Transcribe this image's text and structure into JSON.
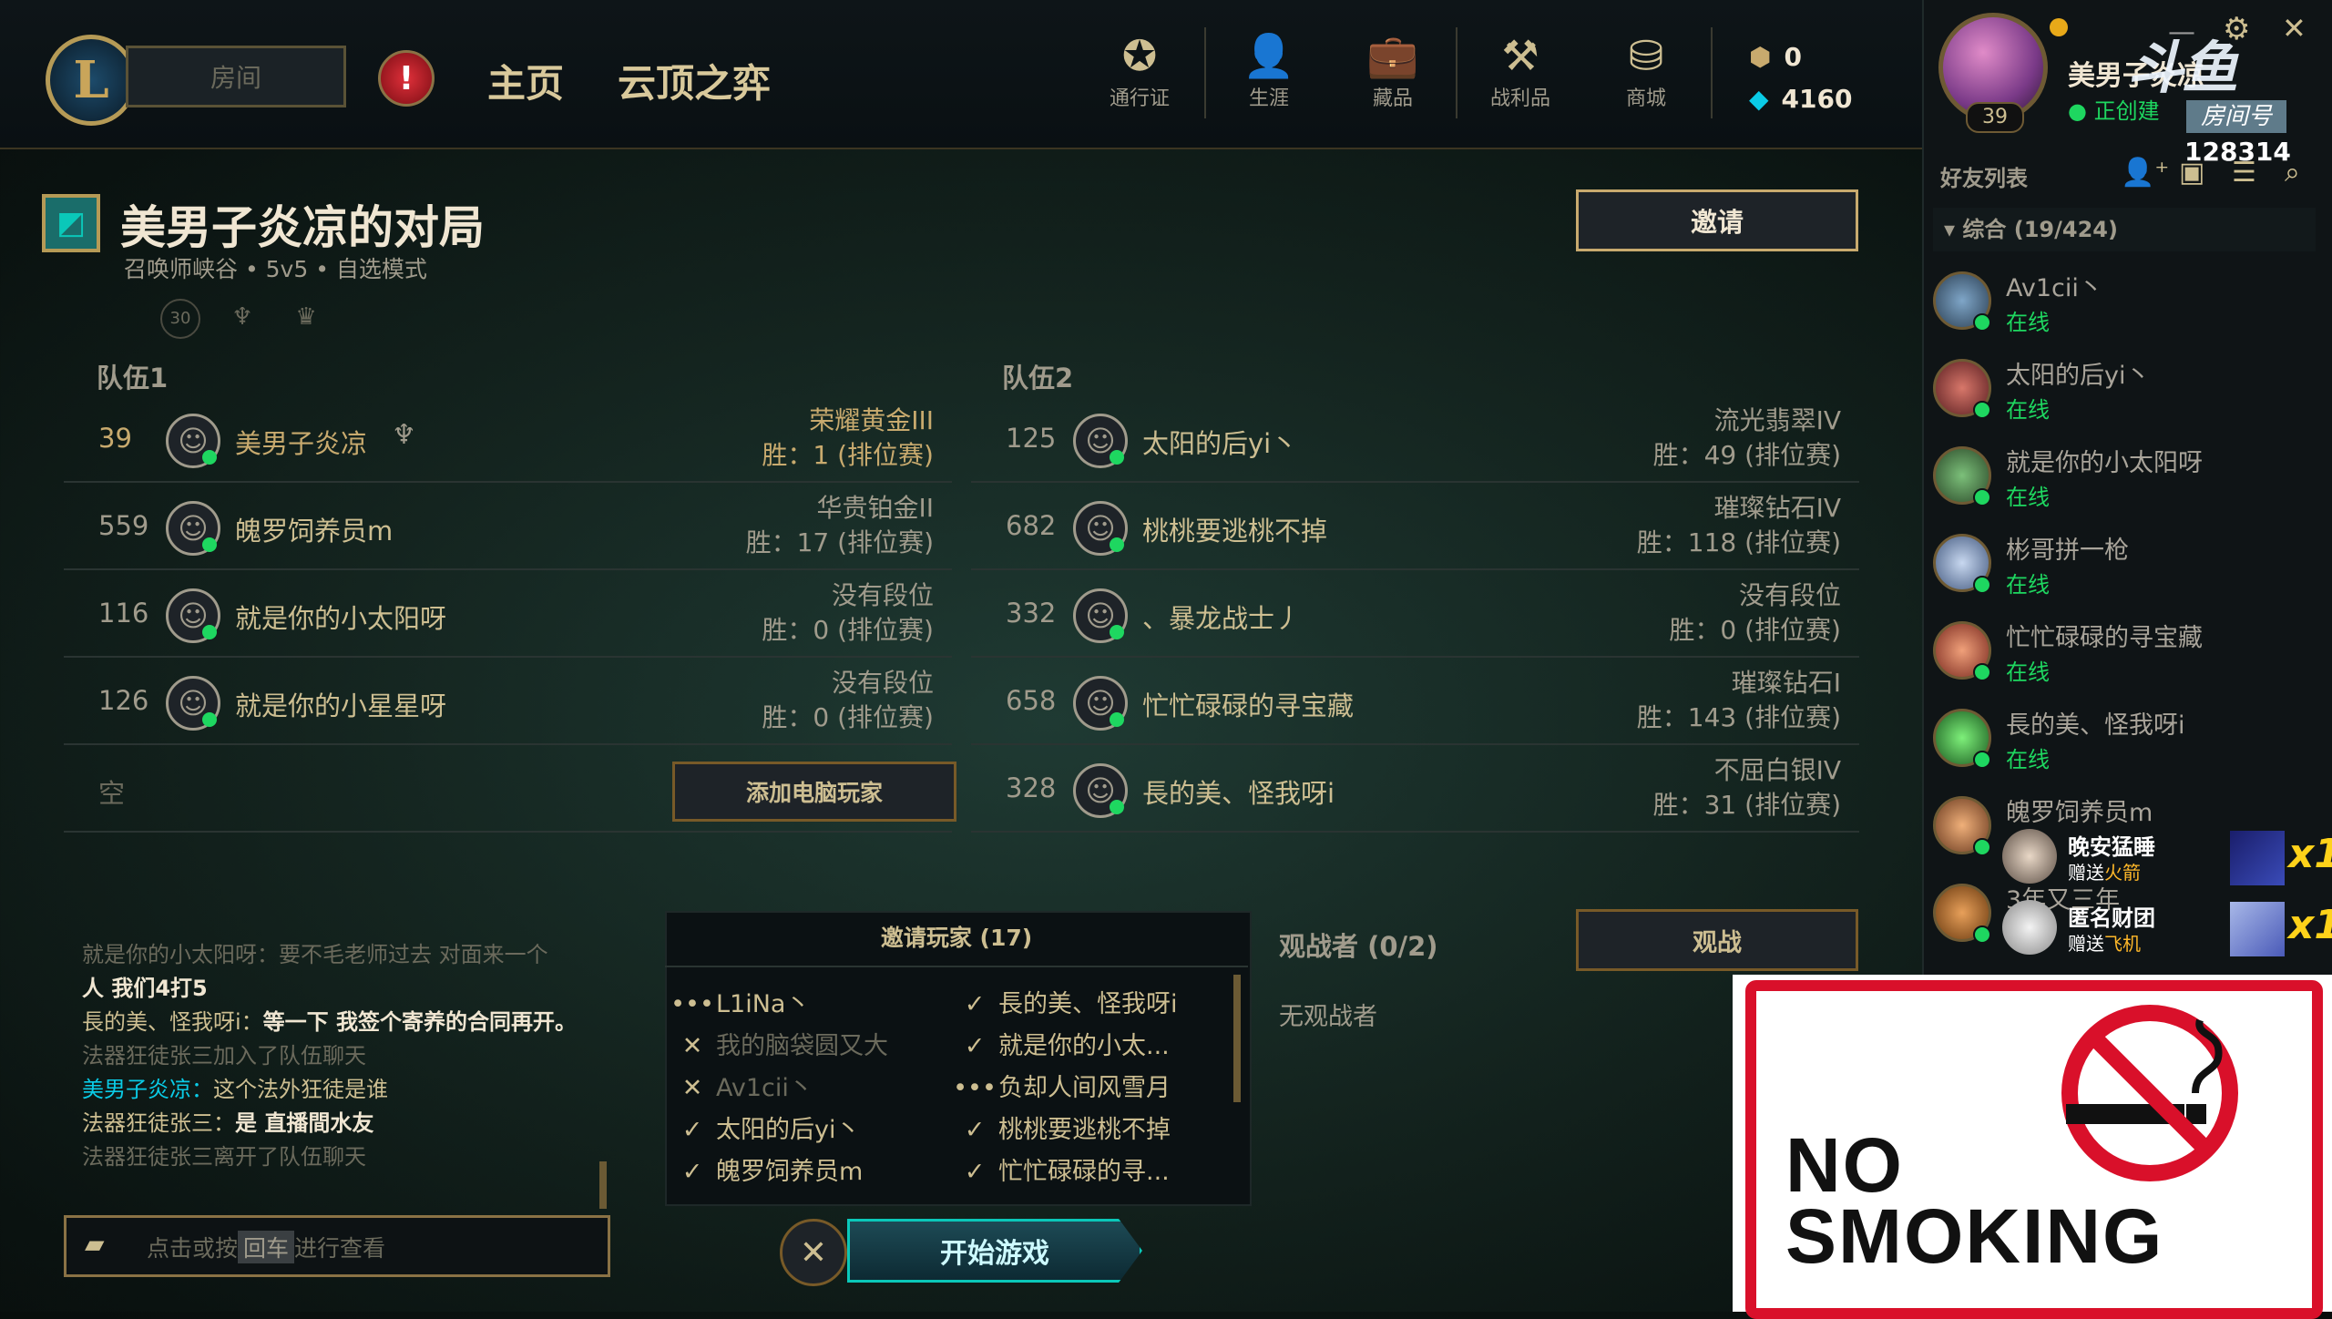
{
  "header": {
    "logo_letter": "L",
    "room_tab": "房间",
    "alert_symbol": "!",
    "nav": [
      "主页",
      "云顶之弈"
    ],
    "icons": [
      {
        "name": "pass",
        "label": "通行证",
        "icon": "✪"
      },
      {
        "name": "profile",
        "label": "生涯",
        "icon": "👤"
      },
      {
        "name": "collection",
        "label": "藏品",
        "icon": "💼"
      },
      {
        "name": "loot",
        "label": "战利品",
        "icon": "⚒"
      },
      {
        "name": "store",
        "label": "商城",
        "icon": "⛁"
      }
    ],
    "rp": "0",
    "be": "4160"
  },
  "social": {
    "level": "39",
    "summoner": "美男子炎凉",
    "status": "正创建",
    "watermark": "斗鱼",
    "room_label": "房间号",
    "room_number": "128314",
    "friends_title": "好友列表",
    "group_label": "综合 (19/424)",
    "friends": [
      {
        "name": "Av1cii丶",
        "status": "在线"
      },
      {
        "name": "太阳的后yi丶",
        "status": "在线"
      },
      {
        "name": "就是你的小太阳呀",
        "status": "在线"
      },
      {
        "name": "彬哥拼一枪",
        "status": "在线"
      },
      {
        "name": "忙忙碌碌的寻宝藏",
        "status": "在线"
      },
      {
        "name": "長的美、怪我呀i",
        "status": "在线"
      },
      {
        "name": "魄罗饲养员m",
        "status": ""
      },
      {
        "name": "3年又三年",
        "status": ""
      }
    ],
    "gifts": [
      {
        "user": "晚安猛睡",
        "prefix": "赠送",
        "gift": "火箭",
        "count": "x1"
      },
      {
        "user": "匿名财团",
        "prefix": "赠送",
        "gift": "飞机",
        "count": "x1"
      }
    ]
  },
  "lobby": {
    "title": "美男子炎凉的对局",
    "subtitle": "召唤师峡谷  •  5v5  •  自选模式",
    "invite_button": "邀请",
    "team1_label": "队伍1",
    "team2_label": "队伍2",
    "team1": [
      {
        "level": "39",
        "name": "美男子炎凉",
        "rank": "荣耀黄金III",
        "wins": "胜：1  (排位赛)"
      },
      {
        "level": "559",
        "name": "魄罗饲养员m",
        "rank": "华贵铂金II",
        "wins": "胜：17  (排位赛)"
      },
      {
        "level": "116",
        "name": "就是你的小太阳呀",
        "rank": "没有段位",
        "wins": "胜：0  (排位赛)"
      },
      {
        "level": "126",
        "name": "就是你的小星星呀",
        "rank": "没有段位",
        "wins": "胜：0  (排位赛)"
      }
    ],
    "empty_slot": "空",
    "add_bot": "添加电脑玩家",
    "team2": [
      {
        "level": "125",
        "name": "太阳的后yi丶",
        "rank": "流光翡翠IV",
        "wins": "胜：49  (排位赛)"
      },
      {
        "level": "682",
        "name": "桃桃要逃桃不掉",
        "rank": "璀璨钻石IV",
        "wins": "胜：118  (排位赛)"
      },
      {
        "level": "332",
        "name": "、暴龙战士丿",
        "rank": "没有段位",
        "wins": "胜：0  (排位赛)"
      },
      {
        "level": "658",
        "name": "忙忙碌碌的寻宝藏",
        "rank": "璀璨钻石I",
        "wins": "胜：143  (排位赛)"
      },
      {
        "level": "328",
        "name": "長的美、怪我呀i",
        "rank": "不屈白银IV",
        "wins": "胜：31  (排位赛)"
      }
    ]
  },
  "chat": {
    "lines": [
      {
        "type": "sys",
        "text": "就是你的小太阳呀：要不毛老师过去 对面来一个"
      },
      {
        "type": "bold",
        "text": "人 我们4打5"
      },
      {
        "type": "msg",
        "speaker": "長的美、怪我呀i：",
        "text": "等一下 我签个寄养的合同再开。"
      },
      {
        "type": "sys",
        "text": "法器狂徒张三加入了队伍聊天"
      },
      {
        "type": "me",
        "speaker": "美男子炎凉：",
        "text": "这个法外狂徒是谁"
      },
      {
        "type": "msg",
        "speaker": "法器狂徒张三：",
        "text": "是 直播間水友"
      },
      {
        "type": "sys",
        "text": "法器狂徒张三离开了队伍聊天"
      }
    ],
    "input_hint_prefix": "点击或按",
    "input_key": "回车",
    "input_hint_suffix": "进行查看"
  },
  "invites": {
    "title": "邀请玩家 (17)",
    "left": [
      {
        "mark": "•••",
        "name": "L1iNa丶",
        "dim": false
      },
      {
        "mark": "✕",
        "name": "我的脑袋圆又大",
        "dim": true
      },
      {
        "mark": "✕",
        "name": "Av1cii丶",
        "dim": true
      },
      {
        "mark": "✓",
        "name": "太阳的后yi丶",
        "dim": false
      },
      {
        "mark": "✓",
        "name": "魄罗饲养员m",
        "dim": false
      }
    ],
    "right": [
      {
        "mark": "✓",
        "name": "長的美、怪我呀i",
        "dim": false
      },
      {
        "mark": "✓",
        "name": "就是你的小太...",
        "dim": false
      },
      {
        "mark": "•••",
        "name": "负却人间风雪月",
        "dim": false
      },
      {
        "mark": "✓",
        "name": "桃桃要逃桃不掉",
        "dim": false
      },
      {
        "mark": "✓",
        "name": "忙忙碌碌的寻...",
        "dim": false
      }
    ]
  },
  "spectators": {
    "label": "观战者 (0/2)",
    "button": "观战",
    "none": "无观战者"
  },
  "footer": {
    "start": "开始游戏",
    "cancel": "✕"
  },
  "overlay": {
    "no_smoking_line1": "NO",
    "no_smoking_line2": "SMOKING"
  }
}
